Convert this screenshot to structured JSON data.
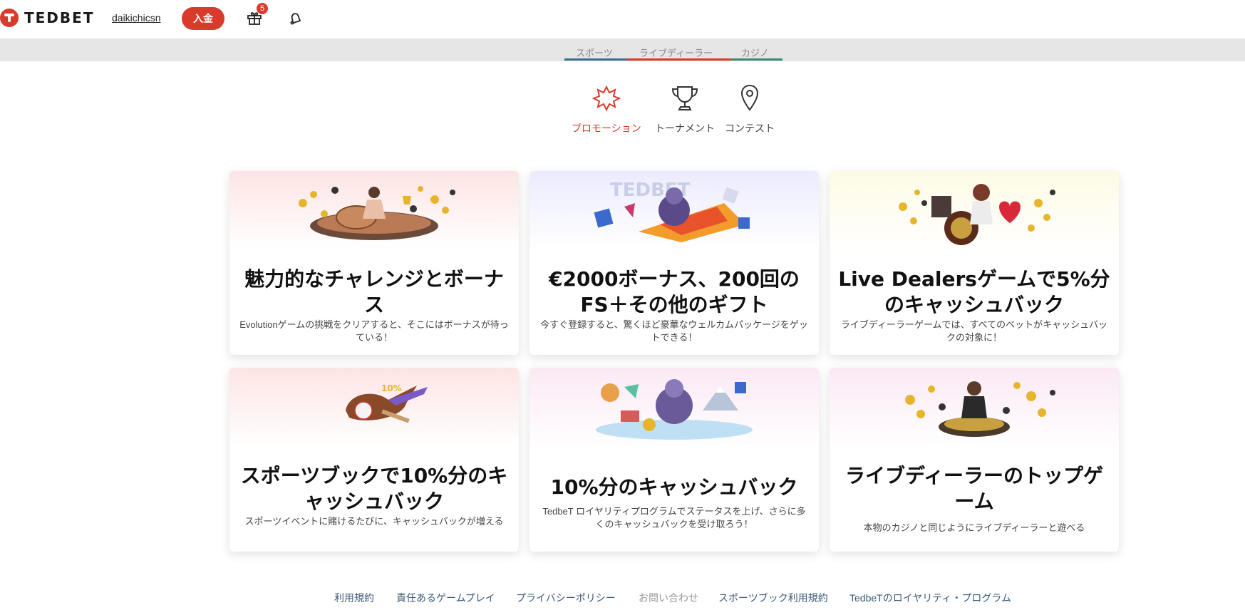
{
  "header": {
    "logo_text": "TEDBET",
    "username": "daikichicsn",
    "deposit_label": "入金",
    "gift_badge": "5",
    "accent": "#d83a2c"
  },
  "categories": [
    {
      "label": "スポーツ",
      "color": "#3a6f8c"
    },
    {
      "label": "ライブディーラー",
      "color": "#d83a2c"
    },
    {
      "label": "カジノ",
      "color": "#3a8c6a"
    }
  ],
  "promo_nav": [
    {
      "label": "プロモーション",
      "icon": "promotion-star-icon",
      "active": true
    },
    {
      "label": "トーナメント",
      "icon": "trophy-icon",
      "active": false
    },
    {
      "label": "コンテスト",
      "icon": "location-pin-icon",
      "active": false
    }
  ],
  "cards": [
    {
      "title": "魅力的なチャレンジとボーナス",
      "desc": "Evolutionゲームの挑戦をクリアすると、そこにはボーナスが待っている！"
    },
    {
      "title": "€2000ボーナス、200回のFS＋その他のギフト",
      "desc": "今すぐ登録すると、驚くほど豪華なウェルカムパッケージをゲットできる！"
    },
    {
      "title": "Live Dealersゲームで5%分のキャッシュバック",
      "desc": "ライブディーラーゲームでは、すべてのベットがキャッシュバックの対象に！"
    },
    {
      "title": "スポーツブックで10%分のキャッシュバック",
      "desc": "スポーツイベントに賭けるたびに、キャッシュバックが増える"
    },
    {
      "title": "10%分のキャッシュバック",
      "desc": "TedbeT ロイヤリティプログラムでステータスを上げ、さらに多くのキャッシュバックを受け取ろう！"
    },
    {
      "title": "ライブディーラーのトップゲーム",
      "desc": "本物のカジノと同じようにライブディーラーと遊べる"
    }
  ],
  "footer": {
    "links": [
      {
        "label": "利用規約"
      },
      {
        "label": "責任あるゲームプレイ"
      },
      {
        "label": "プライバシーポリシー"
      },
      {
        "label": "お問い合わせ"
      },
      {
        "label": "スポーツブック利用規約"
      },
      {
        "label": "TedbeTのロイヤリティ・プログラム"
      }
    ]
  }
}
